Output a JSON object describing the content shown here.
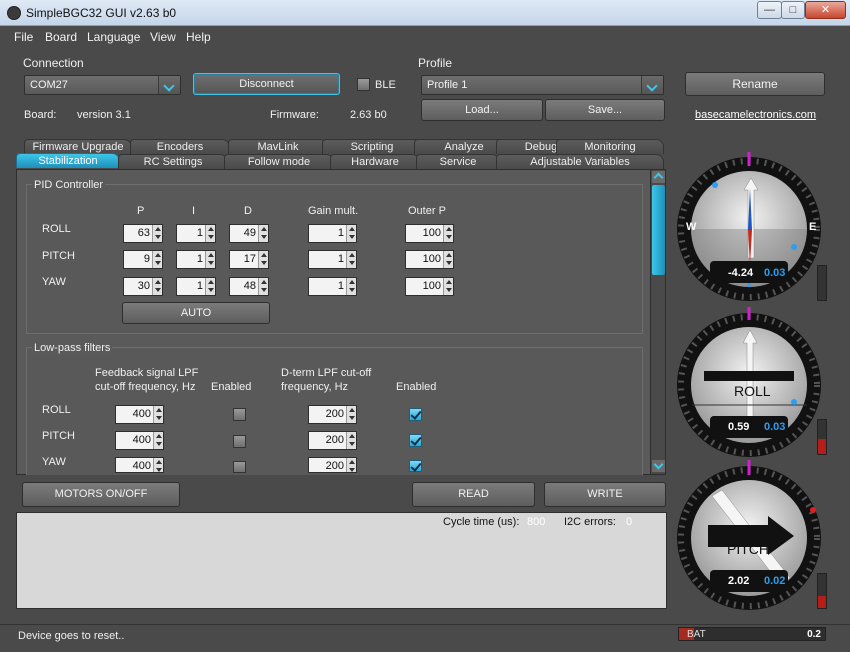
{
  "window": {
    "title": "SimpleBGC32 GUI v2.63 b0",
    "controls": {
      "minimize": "—",
      "maximize": "□",
      "close": "✕"
    }
  },
  "menu": [
    "File",
    "Board",
    "Language",
    "View",
    "Help"
  ],
  "connection": {
    "title": "Connection",
    "port": "COM27",
    "connect_button": "Disconnect",
    "ble_label": "BLE",
    "ble_checked": false,
    "board_label": "Board:",
    "board_value": "version 3.1",
    "firmware_label": "Firmware:",
    "firmware_value": "2.63 b0"
  },
  "profile": {
    "title": "Profile",
    "selected": "Profile 1",
    "load_button": "Load...",
    "save_button": "Save...",
    "rename_button": "Rename",
    "link": "basecamelectronics.com"
  },
  "tabs_back": [
    "Firmware Upgrade",
    "Encoders",
    "MavLink",
    "Scripting",
    "Analyze",
    "Debug",
    "Monitoring"
  ],
  "tabs_front": [
    "Stabilization",
    "RC Settings",
    "Follow mode",
    "Hardware",
    "Service",
    "Adjustable Variables"
  ],
  "active_tab": "Stabilization",
  "pid": {
    "title": "PID Controller",
    "headers": {
      "p": "P",
      "i": "I",
      "d": "D",
      "gain": "Gain mult.",
      "outer": "Outer P"
    },
    "rows": [
      {
        "axis": "ROLL",
        "p": "63",
        "i": "1",
        "d": "49",
        "gain": "1",
        "outer": "100"
      },
      {
        "axis": "PITCH",
        "p": "9",
        "i": "1",
        "d": "17",
        "gain": "1",
        "outer": "100"
      },
      {
        "axis": "YAW",
        "p": "30",
        "i": "1",
        "d": "48",
        "gain": "1",
        "outer": "100"
      }
    ],
    "auto_button": "AUTO"
  },
  "lpf": {
    "title": "Low-pass filters",
    "feedback_header_1": "Feedback signal LPF",
    "feedback_header_2": "cut-off frequency, Hz",
    "enabled_header": "Enabled",
    "dterm_header_1": "D-term LPF cut-off",
    "dterm_header_2": "frequency, Hz",
    "enabled_header_2": "Enabled",
    "rows": [
      {
        "axis": "ROLL",
        "feedback": "400",
        "feedback_enabled": false,
        "dterm": "200",
        "dterm_enabled": true
      },
      {
        "axis": "PITCH",
        "feedback": "400",
        "feedback_enabled": false,
        "dterm": "200",
        "dterm_enabled": true
      },
      {
        "axis": "YAW",
        "feedback": "400",
        "feedback_enabled": false,
        "dterm": "200",
        "dterm_enabled": true
      }
    ]
  },
  "actions": {
    "motors": "MOTORS ON/OFF",
    "read": "READ",
    "write": "WRITE"
  },
  "log": {
    "cycle_label": "Cycle time (us):",
    "cycle_value": "800",
    "i2c_label": "I2C errors:",
    "i2c_value": "0"
  },
  "status": {
    "message": "Device goes to reset..",
    "bat_label": "BAT",
    "bat_value": "0.2",
    "bat_level": 0.1
  },
  "gauges": {
    "yaw": {
      "west": "W",
      "east": "E",
      "angle": "-4.24",
      "rate": "0.03",
      "side_level": 0.0
    },
    "roll": {
      "name": "ROLL",
      "angle": "0.59",
      "rate": "0.03",
      "side_level": 0.45
    },
    "pitch": {
      "name": "PITCH",
      "angle": "2.02",
      "rate": "0.02",
      "side_level": 0.35
    }
  },
  "colors": {
    "accent": "#3cc7ea",
    "panel": "#5a5a5a",
    "window": "#4a4a4a",
    "alert": "#b51d18"
  }
}
